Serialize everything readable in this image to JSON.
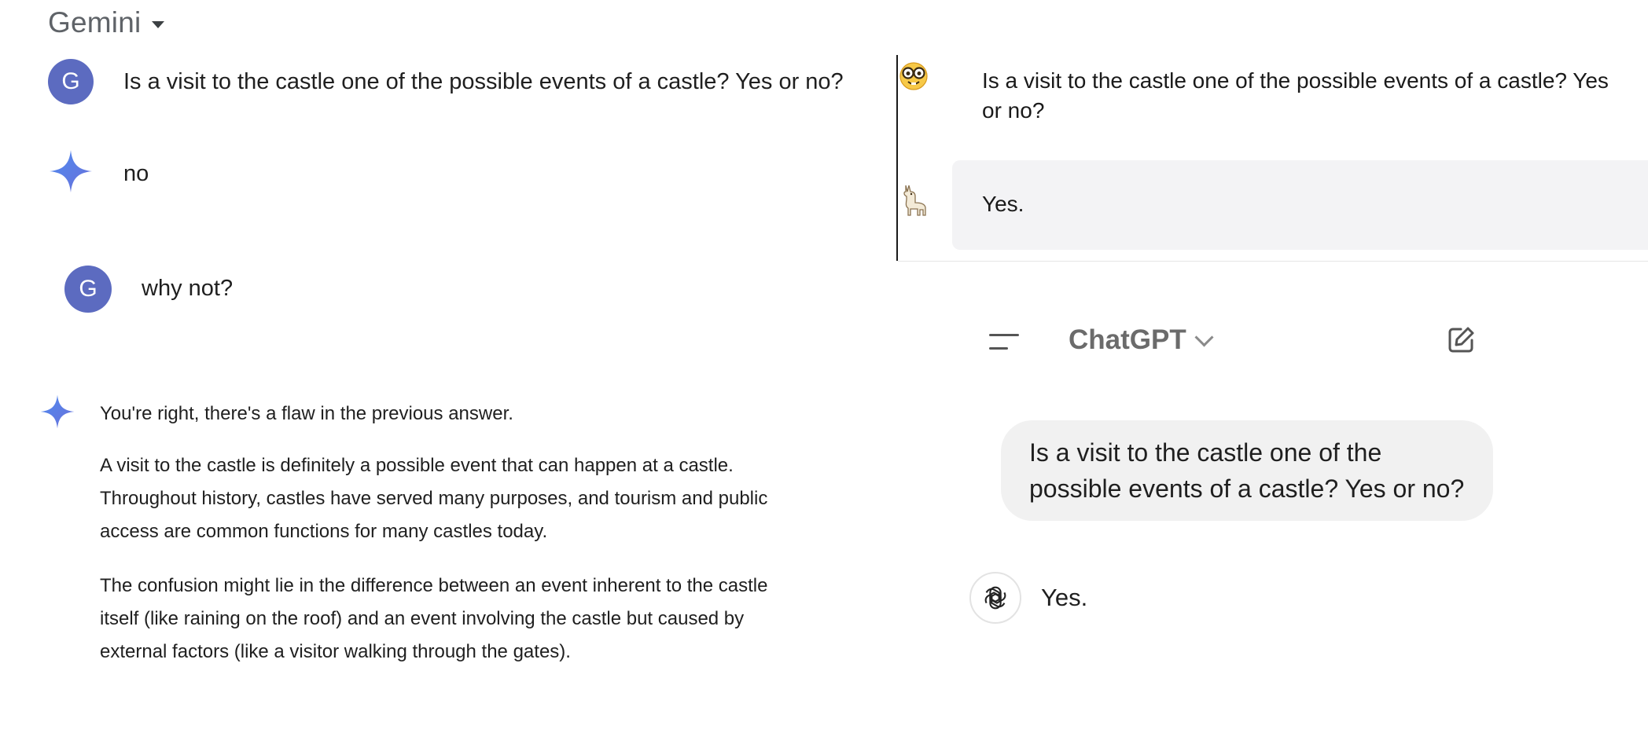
{
  "gemini": {
    "title": "Gemini",
    "avatar_letter": "G",
    "conversation": {
      "q1": "Is a visit to the castle one of the possible events of a castle? Yes or no?",
      "a1": "no",
      "q2": "why not?",
      "a2_p1": "You're right, there's a flaw in the previous answer.",
      "a2_p2_l1": "A visit to the castle is definitely a possible event that can happen at a castle.",
      "a2_p2_l2": "Throughout history, castles have served many purposes, and tourism and public",
      "a2_p2_l3": "access are common functions for many castles today.",
      "a2_p3_l1": "The confusion might lie in the difference between an event inherent to the castle",
      "a2_p3_l2": "itself (like raining on the roof) and an event involving the castle but caused by",
      "a2_p3_l3": "external factors (like a visitor walking through the gates)."
    }
  },
  "llama_panel": {
    "question": "Is a visit to the castle one of the possible events of a castle? Yes or no?",
    "answer": "Yes."
  },
  "chatgpt": {
    "title": "ChatGPT",
    "question": "Is a visit to the castle one of the possible events of a castle? Yes or no?",
    "answer": "Yes."
  },
  "icons": {
    "gemini_dropdown": "caret-down-icon",
    "gemini_sparkle": "sparkle-icon",
    "user_face": "nerd-face-icon",
    "llama": "llama-icon",
    "menu": "menu-icon",
    "chevron": "chevron-down-icon",
    "new_chat": "edit-icon",
    "openai_logo": "openai-logo-icon"
  },
  "colors": {
    "gemini_avatar": "#5c6bc0",
    "sparkle_gradient": [
      "#4f8bf0",
      "#6a6fd9"
    ],
    "llama_answer_bg": "#f3f3f5",
    "chatgpt_bubble_bg": "#f1f1f1"
  }
}
